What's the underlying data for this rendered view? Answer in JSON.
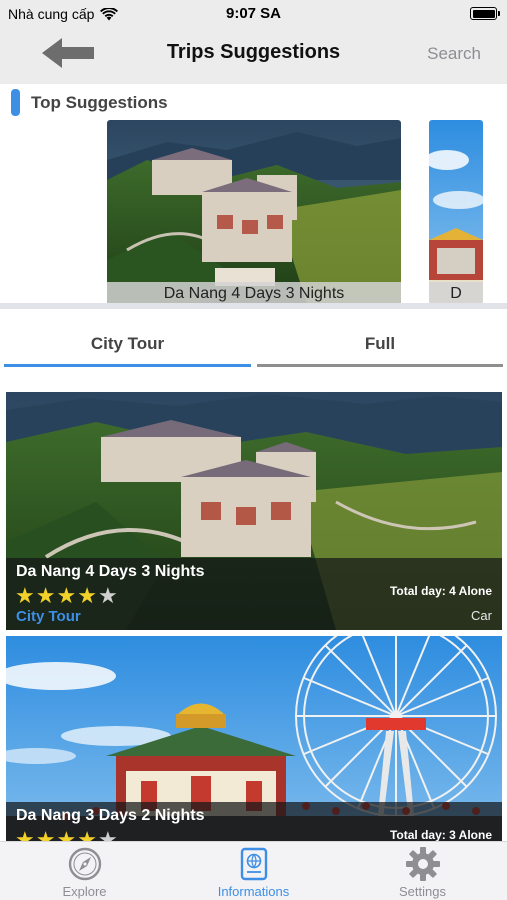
{
  "status_bar": {
    "carrier": "Nhà cung cấp",
    "time": "9:07 SA",
    "battery_level": 0.92
  },
  "nav": {
    "back_icon": "back-arrow-icon",
    "title": "Trips Suggestions",
    "search_label": "Search"
  },
  "top_suggestions": {
    "title": "Top Suggestions",
    "accent_color": "#3d8fe6",
    "cards": [
      {
        "caption": "Da Nang 4 Days 3 Nights"
      },
      {
        "caption": "D"
      }
    ]
  },
  "tabs": [
    {
      "label": "City Tour",
      "selected": true,
      "line_color": "#3d8fe6"
    },
    {
      "label": "Full",
      "selected": false,
      "line_color": "#8e8e8e"
    }
  ],
  "trips": [
    {
      "title": "Da Nang 4 Days 3 Nights",
      "rating": 4,
      "rating_max": 5,
      "category": "City Tour",
      "total_days": "Total day: 4 Alone",
      "vehicle": "Car"
    },
    {
      "title": "Da Nang 3 Days 2 Nights",
      "rating": 4,
      "rating_max": 5,
      "category": "",
      "total_days": "Total day: 3 Alone",
      "vehicle": ""
    }
  ],
  "tab_bar": {
    "items": [
      {
        "label": "Explore",
        "icon": "compass-icon",
        "active": false
      },
      {
        "label": "Informations",
        "icon": "passport-icon",
        "active": true
      },
      {
        "label": "Settings",
        "icon": "gear-icon",
        "active": false
      }
    ],
    "active_color": "#3d8fe6",
    "inactive_color": "#8e8e93"
  }
}
